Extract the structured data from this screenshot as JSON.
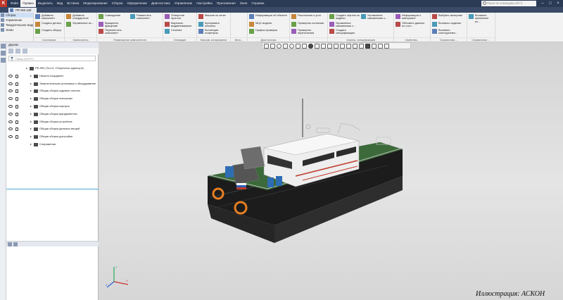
{
  "menubar": {
    "items": [
      "Файл",
      "Правка",
      "Выделить",
      "Вид",
      "Вставка",
      "Моделирование",
      "Сборка",
      "Оформление",
      "Диагностика",
      "Управление",
      "Настройка",
      "Приложения",
      "Окно",
      "Справка"
    ],
    "active_index": 1,
    "search_placeholder": "Поиск по командам (Alt+/)"
  },
  "document": {
    "tab_label": "PR-950.a3d"
  },
  "ribbon": {
    "left_panel": [
      "Сборка",
      "Управление",
      "Твердотельное моделирование",
      "Эскиз"
    ],
    "groups": [
      {
        "name": "Системная",
        "buttons": [
          "Добавить компонент",
          "Создать деталь",
          "Создать сборку"
        ]
      },
      {
        "name": "Компоненты",
        "buttons": [
          "Добавить стандартное",
          "Управление ис..."
        ]
      },
      {
        "name": "Размещение компонентов",
        "buttons": [
          "Совпадение",
          "Вращение-вращение",
          "Переместить компонент",
          "Разместить компонент"
        ]
      },
      {
        "name": "Операции",
        "buttons": [
          "Отверстие простое",
          "Вырезать выдавливанием",
          "Сечение"
        ]
      },
      {
        "name": "Массив, копирование",
        "buttons": [
          "Массив по сетке",
          "Копировать объекты",
          "Коллекция геометрии"
        ]
      },
      {
        "name": "Вспо...",
        "buttons": []
      },
      {
        "name": "Диагностика",
        "buttons": [
          "Информация об объекте",
          "МЦХ модели",
          "График проверки"
        ]
      },
      {
        "name": "",
        "buttons": [
          "Расстояние и угол",
          "Проверить коллизии",
          "Проверить пересечения"
        ]
      },
      {
        "name": "Чертеж, спецификация",
        "buttons": [
          "Создать чертеж по модели",
          "Управление связанными с...",
          "Создать спецификацию",
          "Управление связанными ч..."
        ]
      },
      {
        "name": "Свойства...",
        "buttons": [
          "Информация о материале",
          "Обновить данные по сост..."
        ]
      },
      {
        "name": "Справочная ...",
        "buttons": [
          "Выбрать материал",
          "Вставить изделие",
          "Вставить конструктивн..."
        ]
      },
      {
        "name": "Справочные ...",
        "buttons": [
          "Вставить крепежное из..."
        ]
      }
    ]
  },
  "tree": {
    "title": "Дерево",
    "filter_placeholder": "Поиск (Ctrl+F)",
    "rows": [
      {
        "label": "PR-950 (Тел-0, Сборочных единиц-8)",
        "level": 0,
        "root": true
      },
      {
        "label": "Начало координат",
        "level": 1
      },
      {
        "label": "Энергетическая установка и оборудование",
        "level": 1
      },
      {
        "label": "Общая сборка судовых систем",
        "level": 1
      },
      {
        "label": "Общая сборка электрики",
        "level": 1
      },
      {
        "label": "Общая сборка корпуса",
        "level": 1
      },
      {
        "label": "Общая сборка фундаментов",
        "level": 1
      },
      {
        "label": "Общая сборка устройств",
        "level": 1
      },
      {
        "label": "Общая сборка дельных вещей",
        "level": 1
      },
      {
        "label": "Общая сборка достройки",
        "level": 1
      },
      {
        "label": "Сопряжения",
        "level": 1
      }
    ]
  },
  "viewport": {
    "axis_labels": [
      "X",
      "Y",
      "Z"
    ]
  },
  "credit": "Иллюстрация: АСКОН",
  "colors": {
    "menubar": "#2b3a55",
    "ribbon": "#f2f2f2",
    "accent": "#4fa3d6"
  }
}
